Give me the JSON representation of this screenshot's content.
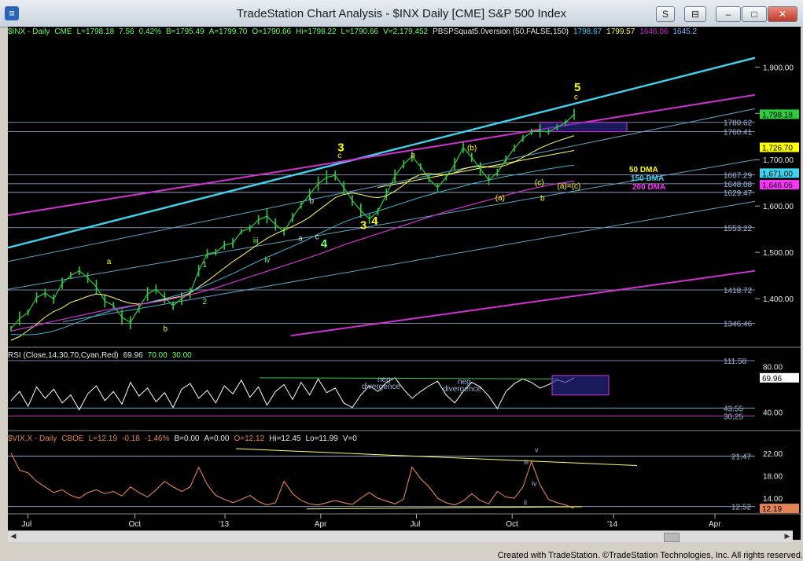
{
  "window": {
    "title": "TradeStation Chart Analysis - $INX Daily [CME] S&P 500 Index",
    "buttons": [
      "S",
      "⊟",
      "–",
      "□",
      "✕"
    ]
  },
  "status_bar": "Created with TradeStation. ©TradeStation Technologies, Inc. All rights reserved.",
  "colors": {
    "background": "#000000",
    "price_bars": "#2ecc40",
    "cyan": "#3fd3f0",
    "magenta": "#d431d4",
    "yellow": "#ffff00",
    "vix": "#e2835a",
    "label_green": "#6cff6c"
  },
  "price_header": {
    "items": [
      "$INX - Daily",
      "CME",
      "L=1798.18",
      "7.56",
      "0.42%",
      "B=1795.49",
      "A=1799.70",
      "O=1790.66",
      "Hi=1798.22",
      "L=1790.66",
      "V=2,179,452",
      "PBSPSquat5.0version (50,FALSE,150)",
      "1798.67",
      "1799.57",
      "1646.06",
      "1645.2"
    ]
  },
  "rsi_header": {
    "items": [
      "RSI (Close,14,30,70,Cyan,Red)",
      "69.96",
      "70.00",
      "30.00"
    ]
  },
  "vix_header": {
    "items": [
      "$VIX.X - Daily",
      "CBOE",
      "L=12.19",
      "-0.18",
      "-1.46%",
      "B=0.00",
      "A=0.00",
      "O=12.12",
      "Hi=12.45",
      "Lo=11.99",
      "V=0"
    ]
  },
  "chart_data": [
    {
      "type": "line",
      "name": "price",
      "x_tick_labels": [
        "Jul",
        "Oct",
        "'13",
        "Apr",
        "Jul",
        "Oct",
        "'14",
        "Apr"
      ],
      "y_tick_labels": [
        "1,900.00",
        "1,800.00",
        "1,700.00",
        "1,600.00",
        "1,500.00",
        "1,400.00"
      ],
      "ylim": [
        1300,
        1960
      ],
      "series": [
        {
          "name": "$INX",
          "values": [
            1335,
            1357,
            1370,
            1402,
            1412,
            1399,
            1433,
            1450,
            1460,
            1445,
            1425,
            1395,
            1385,
            1360,
            1348,
            1380,
            1410,
            1420,
            1402,
            1385,
            1400,
            1412,
            1460,
            1497,
            1500,
            1515,
            1520,
            1545,
            1552,
            1570,
            1578,
            1560,
            1545,
            1575,
            1602,
            1625,
            1648,
            1662,
            1666,
            1640,
            1612,
            1590,
            1572,
            1588,
            1625,
            1665,
            1690,
            1707,
            1685,
            1658,
            1640,
            1662,
            1690,
            1726,
            1705,
            1680,
            1656,
            1672,
            1700,
            1725,
            1746,
            1760,
            1762,
            1760,
            1770,
            1780,
            1798
          ]
        },
        {
          "name": "50 DMA",
          "values": [
            1310,
            1318,
            1331,
            1345,
            1360,
            1372,
            1380,
            1392,
            1398,
            1405,
            1410,
            1408,
            1402,
            1395,
            1390,
            1388,
            1390,
            1394,
            1398,
            1402,
            1405,
            1412,
            1425,
            1438,
            1452,
            1466,
            1480,
            1492,
            1505,
            1518,
            1530,
            1540,
            1548,
            1556,
            1565,
            1576,
            1590,
            1604,
            1618,
            1625,
            1628,
            1625,
            1620,
            1618,
            1622,
            1632,
            1645,
            1660,
            1668,
            1670,
            1668,
            1668,
            1672,
            1680,
            1684,
            1686,
            1684,
            1684,
            1688,
            1695,
            1705,
            1715,
            1725,
            1733,
            1740,
            1746,
            1752
          ]
        },
        {
          "name": "150 DMA",
          "values": [
            1323,
            1322,
            1322,
            1323,
            1326,
            1330,
            1336,
            1343,
            1350,
            1357,
            1364,
            1370,
            1375,
            1379,
            1383,
            1387,
            1391,
            1396,
            1400,
            1405,
            1410,
            1416,
            1422,
            1430,
            1438,
            1446,
            1454,
            1463,
            1472,
            1481,
            1489,
            1497,
            1505,
            1513,
            1521,
            1530,
            1539,
            1548,
            1557,
            1565,
            1572,
            1578,
            1584,
            1589,
            1595,
            1601,
            1607,
            1613,
            1619,
            1624,
            1629,
            1634,
            1638,
            1643,
            1648,
            1652,
            1656,
            1660,
            1664,
            1667,
            1670,
            1674,
            1677,
            1680,
            1683,
            1686,
            1688
          ]
        },
        {
          "name": "200 DMA",
          "values": [
            1330,
            1334,
            1338,
            1342,
            1347,
            1351,
            1355,
            1359,
            1363,
            1367,
            1371,
            1375,
            1378,
            1381,
            1384,
            1387,
            1390,
            1393,
            1396,
            1400,
            1404,
            1408,
            1413,
            1418,
            1423,
            1429,
            1435,
            1441,
            1447,
            1453,
            1459,
            1465,
            1471,
            1477,
            1483,
            1489,
            1495,
            1502,
            1509,
            1516,
            1522,
            1528,
            1534,
            1540,
            1546,
            1552,
            1558,
            1564,
            1570,
            1576,
            1582,
            1588,
            1593,
            1598,
            1603,
            1608,
            1613,
            1618,
            1623,
            1628,
            1633,
            1637,
            1641,
            1645,
            1648,
            1651,
            1654
          ]
        }
      ],
      "horizontal_levels": [
        "1780.62",
        "1760.41",
        "1667.29",
        "1648.08",
        "1629.47",
        "1553.22",
        "1418.72",
        "1346.46"
      ],
      "last_value_labels": [
        "1,798.18",
        "1,726.70",
        "1,671.00",
        "1,646.06"
      ],
      "legend": [
        "50 DMA",
        "150 DMA",
        "200 DMA"
      ],
      "wave_labels": [
        "a",
        "b",
        "1",
        "2",
        "iii",
        "iv",
        "3",
        "a",
        "b",
        "c",
        "4",
        "3",
        "c",
        "4",
        "a",
        "(b)",
        "(a)",
        "(c)",
        "b",
        "(a)=(c)",
        "5",
        "c"
      ]
    },
    {
      "type": "line",
      "name": "RSI",
      "y_tick_labels": [
        "80.00",
        "40.00"
      ],
      "ylim": [
        30,
        85
      ],
      "level_labels": [
        "111.58",
        "43.55",
        "30.25"
      ],
      "last_value_label": "69.96",
      "annotations": [
        "neg",
        "divergence",
        "neg",
        "divergence"
      ],
      "series": [
        {
          "values": [
            50,
            58,
            45,
            62,
            52,
            60,
            48,
            55,
            42,
            56,
            63,
            50,
            58,
            47,
            66,
            54,
            61,
            49,
            57,
            44,
            60,
            65,
            52,
            59,
            48,
            63,
            56,
            68,
            53,
            62,
            46,
            58,
            64,
            51,
            66,
            55,
            69,
            57,
            61,
            48,
            44,
            55,
            63,
            58,
            66,
            70,
            60,
            52,
            58,
            63,
            67,
            55,
            48,
            58,
            66,
            62,
            54,
            43,
            58,
            65,
            69,
            66,
            61,
            64,
            68,
            66,
            70
          ]
        }
      ]
    },
    {
      "type": "line",
      "name": "VIX",
      "y_tick_labels": [
        "22.00",
        "18.00",
        "14.00"
      ],
      "ylim": [
        11.5,
        23.5
      ],
      "level_labels": [
        "21.47",
        "12.52"
      ],
      "last_value_label": "12.19",
      "wave_labels": [
        "iii",
        "iv",
        "v",
        "ii"
      ],
      "series": [
        {
          "values": [
            22,
            19,
            18.5,
            17,
            16,
            15,
            15.5,
            14.5,
            14,
            15,
            15.5,
            14.8,
            15.2,
            14.4,
            16,
            15,
            14.2,
            15.5,
            17,
            16,
            15.2,
            16,
            19.5,
            16.4,
            14.5,
            13.8,
            13.2,
            13.8,
            14.5,
            13.4,
            12.8,
            13.2,
            17,
            14.8,
            13.6,
            13,
            12.8,
            13.2,
            13.6,
            13.2,
            12.9,
            14,
            15,
            14,
            13.5,
            13,
            13.8,
            19.5,
            17.5,
            16,
            14,
            13.2,
            12.8,
            13.5,
            14.8,
            13.6,
            13,
            15.2,
            14.2,
            14,
            16,
            20.5,
            16.4,
            13.8,
            13.2,
            12.8,
            12.2
          ]
        }
      ]
    }
  ]
}
